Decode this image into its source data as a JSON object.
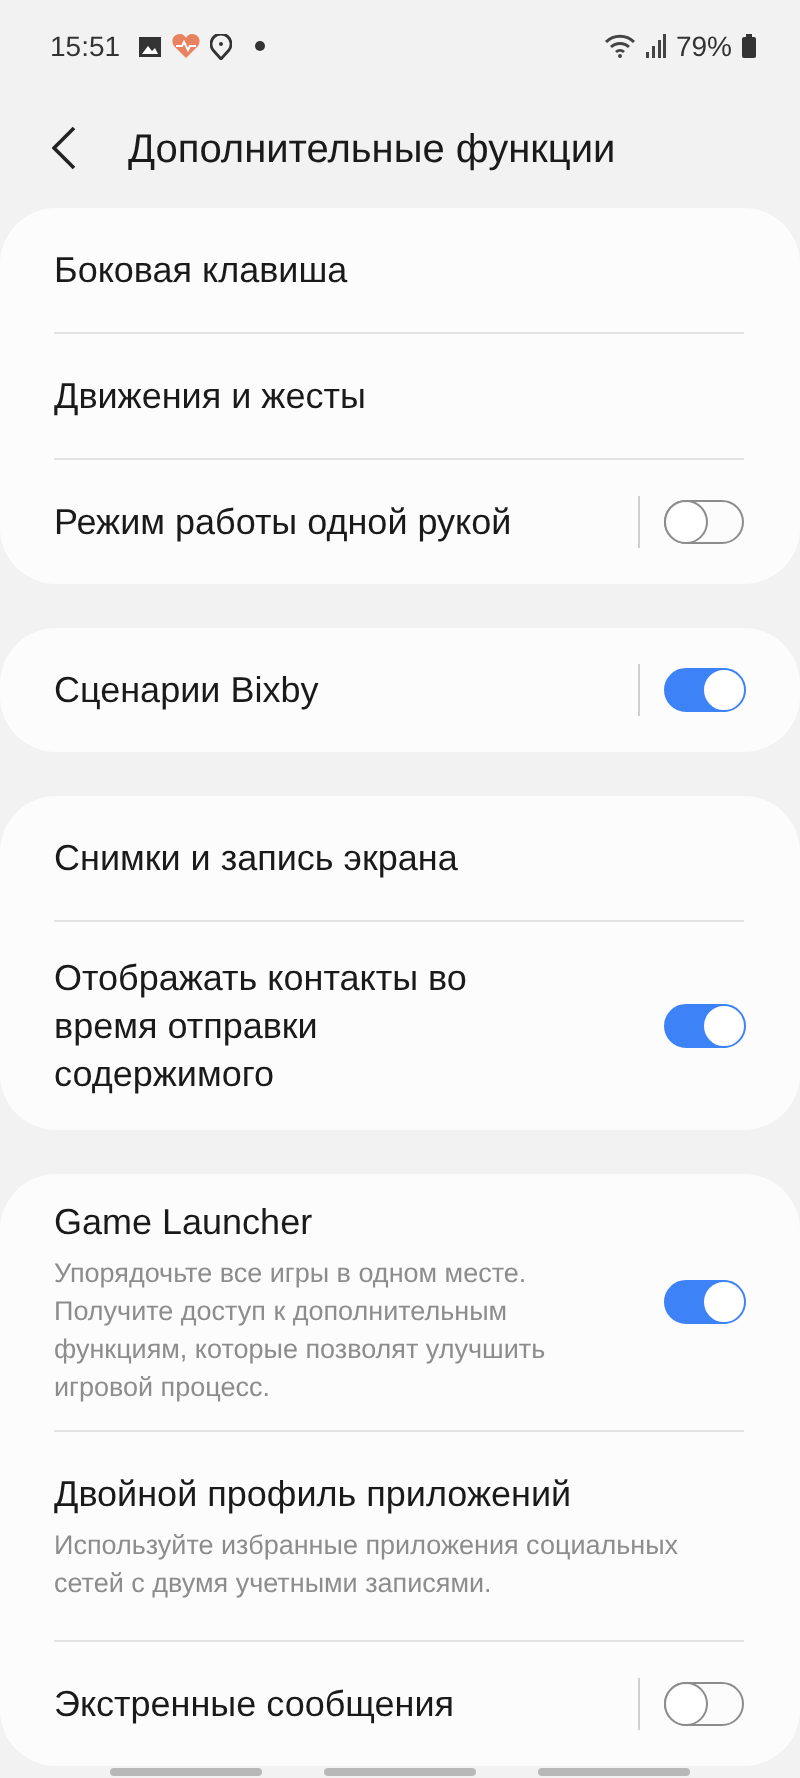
{
  "status_bar": {
    "time": "15:51",
    "battery": "79%"
  },
  "header": {
    "title": "Дополнительные функции"
  },
  "groups": [
    {
      "items": [
        {
          "kind": "plain",
          "title": "Боковая клавиша"
        },
        {
          "kind": "plain",
          "title": "Движения и жесты"
        },
        {
          "kind": "toggle",
          "title": "Режим работы одной рукой",
          "on": false,
          "separated": true
        }
      ]
    },
    {
      "items": [
        {
          "kind": "toggle",
          "title": "Сценарии Bixby",
          "on": true,
          "separated": true
        }
      ]
    },
    {
      "items": [
        {
          "kind": "plain",
          "title": "Снимки и запись экрана"
        },
        {
          "kind": "toggle",
          "title": "Отображать контакты во время отправки содержимого",
          "on": true,
          "separated": false
        }
      ]
    },
    {
      "items": [
        {
          "kind": "toggle",
          "title": "Game Launcher",
          "description": "Упорядочьте все игры в одном месте. Получите доступ к дополнительным функциям, которые позволят улучшить игровой процесс.",
          "on": true,
          "separated": false
        },
        {
          "kind": "plain",
          "title": "Двойной профиль приложений",
          "description": "Используйте избранные приложения социальных сетей с двумя учетными записями."
        },
        {
          "kind": "toggle",
          "title": "Экстренные сообщения",
          "on": false,
          "separated": true
        }
      ]
    }
  ]
}
